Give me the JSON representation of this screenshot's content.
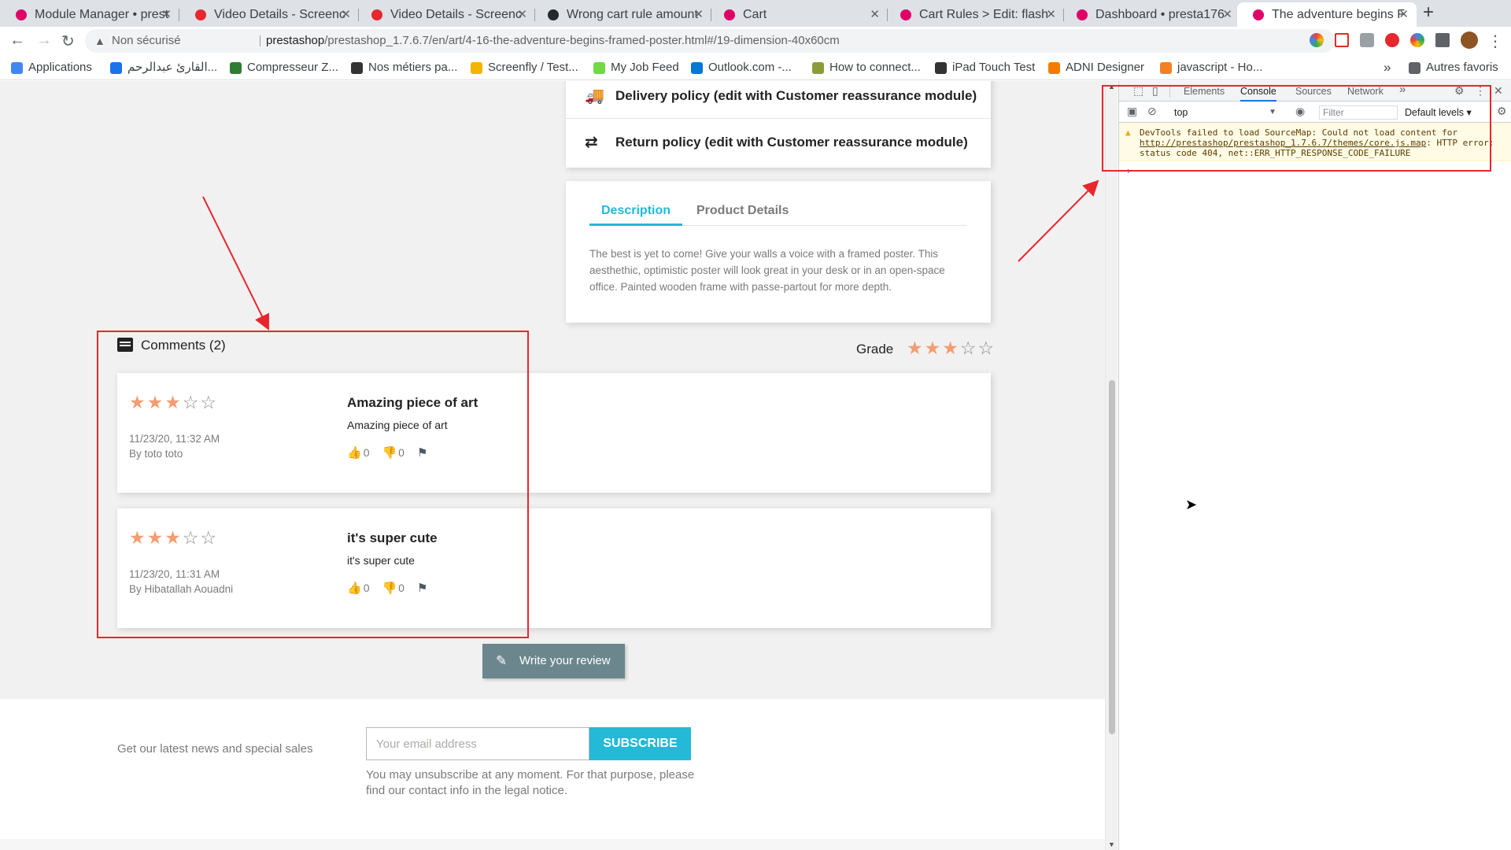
{
  "browser": {
    "tabs": [
      {
        "title": "Module Manager • prest",
        "favicon_color": "#df0067"
      },
      {
        "title": "Video Details - Screenc",
        "favicon_color": "#e8262d"
      },
      {
        "title": "Video Details - Screenc",
        "favicon_color": "#e8262d"
      },
      {
        "title": "Wrong cart rule amount",
        "favicon_color": "#24292e"
      },
      {
        "title": "Cart",
        "favicon_color": "#df0067"
      },
      {
        "title": "Cart Rules > Edit: flash",
        "favicon_color": "#df0067"
      },
      {
        "title": "Dashboard • presta176",
        "favicon_color": "#df0067"
      },
      {
        "title": "The adventure begins F",
        "favicon_color": "#df0067",
        "active": true
      }
    ],
    "new_tab_label": "+",
    "address": {
      "security_label": "Non sécurisé",
      "url_host": "prestashop",
      "url_path": "/prestashop_1.7.6.7/en/art/4-16-the-adventure-begins-framed-poster.html#/19-dimension-40x60cm"
    },
    "bookmarks": [
      {
        "label": "Applications",
        "icon_color": "#4285f4"
      },
      {
        "label": "القارئ عبدالرحم...",
        "icon_color": "#1a73e8"
      },
      {
        "label": "Compresseur Z...",
        "icon_color": "#2e7d32"
      },
      {
        "label": "Nos métiers pa...",
        "icon_color": "#333333"
      },
      {
        "label": "Screenfly / Test...",
        "icon_color": "#f4b400"
      },
      {
        "label": "My Job Feed",
        "icon_color": "#6fda44"
      },
      {
        "label": "Outlook.com -...",
        "icon_color": "#0078d4"
      },
      {
        "label": "How to connect...",
        "icon_color": "#8d9b3a"
      },
      {
        "label": "iPad Touch Test",
        "icon_color": "#333333"
      },
      {
        "label": "ADNI Designer",
        "icon_color": "#f57c00"
      },
      {
        "label": "javascript - Ho...",
        "icon_color": "#f48024"
      }
    ],
    "bookmarks_overflow": "»",
    "other_bookmarks": "Autres favoris"
  },
  "page": {
    "policies": [
      {
        "label": "Delivery policy (edit with Customer reassurance module)",
        "icon": "truck-icon"
      },
      {
        "label": "Return policy (edit with Customer reassurance module)",
        "icon": "swap-arrows-icon"
      }
    ],
    "product_tabs": [
      {
        "label": "Description",
        "active": true
      },
      {
        "label": "Product Details",
        "active": false
      }
    ],
    "description": "The best is yet to come! Give your walls a voice with a framed poster. This aesthethic, optimistic poster will look great in your desk or in an open-space office. Painted wooden frame with passe-partout for more depth.",
    "comments_title": "Comments (2)",
    "grade_label": "Grade",
    "grade_value": 3,
    "grade_max": 5,
    "comments": [
      {
        "rating": 3,
        "date": "11/23/20, 11:32 AM",
        "author": "By toto toto",
        "title": "Amazing piece of art",
        "text": "Amazing piece of art",
        "likes": "0",
        "dislikes": "0"
      },
      {
        "rating": 3,
        "date": "11/23/20, 11:31 AM",
        "author": "By Hibatallah Aouadni",
        "title": "it's super cute",
        "text": "it's super cute",
        "likes": "0",
        "dislikes": "0"
      }
    ],
    "write_review_label": "Write your review",
    "newsletter_label": "Get our latest news and special sales",
    "email_placeholder": "Your email address",
    "subscribe_label": "SUBSCRIBE",
    "unsubscribe_note": "You may unsubscribe at any moment. For that purpose, please find our contact info in the legal notice."
  },
  "devtools": {
    "tabs": [
      "Elements",
      "Console",
      "Sources",
      "Network"
    ],
    "active_tab": "Console",
    "more_label": "»",
    "context": "top",
    "filter_placeholder": "Filter",
    "levels": "Default levels ▾",
    "warning_prefix": "DevTools failed to load SourceMap: Could not load content for ",
    "warning_link": "http://prestashop/prestashop_1.7.6.7/themes/core.js.map",
    "warning_suffix": ": HTTP error: status code 404, net::ERR_HTTP_RESPONSE_CODE_FAILURE",
    "prompt": "›"
  },
  "colors": {
    "accent": "#24b9d7",
    "star": "#f39d72",
    "annotation": "#e8262d",
    "button": "#6c868e"
  }
}
